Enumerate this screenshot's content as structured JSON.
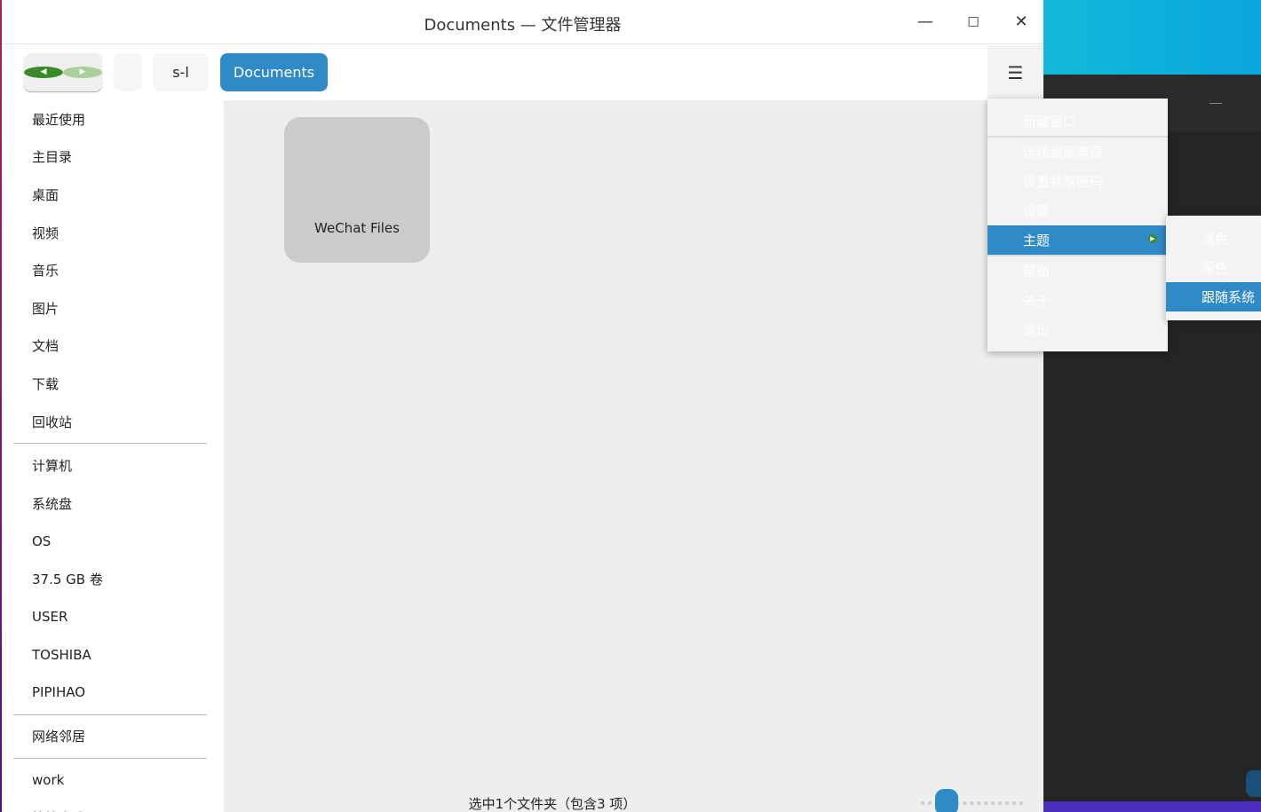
{
  "window": {
    "title": "Documents — 文件管理器"
  },
  "toolbar": {
    "back": "back",
    "forward": "forward",
    "crumbs": [
      "",
      "s-l",
      "Documents"
    ],
    "menu": "☰"
  },
  "sidebar": {
    "items": [
      "最近使用",
      "主目录",
      "桌面",
      "视频",
      "音乐",
      "图片",
      "文档",
      "下载",
      "回收站"
    ],
    "devices": [
      "计算机",
      "系统盘",
      "OS",
      "37.5 GB 卷",
      "USER",
      "TOSHIBA",
      "PIPIHAO"
    ],
    "network": [
      "网络邻居"
    ],
    "bookmarks": [
      "work",
      "快捷方式"
    ]
  },
  "content": {
    "folders": [
      {
        "name": "WeChat Files"
      }
    ],
    "status": "选中1个文件夹（包含3 项）"
  },
  "menu": {
    "items": [
      "新建窗口",
      "连接到服务器",
      "设置共享密码",
      "设置",
      "主题",
      "帮助",
      "关于",
      "退出"
    ],
    "submenu": [
      "浅色",
      "深色",
      "跟随系统"
    ]
  },
  "colors": {
    "accent": "#2f8ac8"
  }
}
